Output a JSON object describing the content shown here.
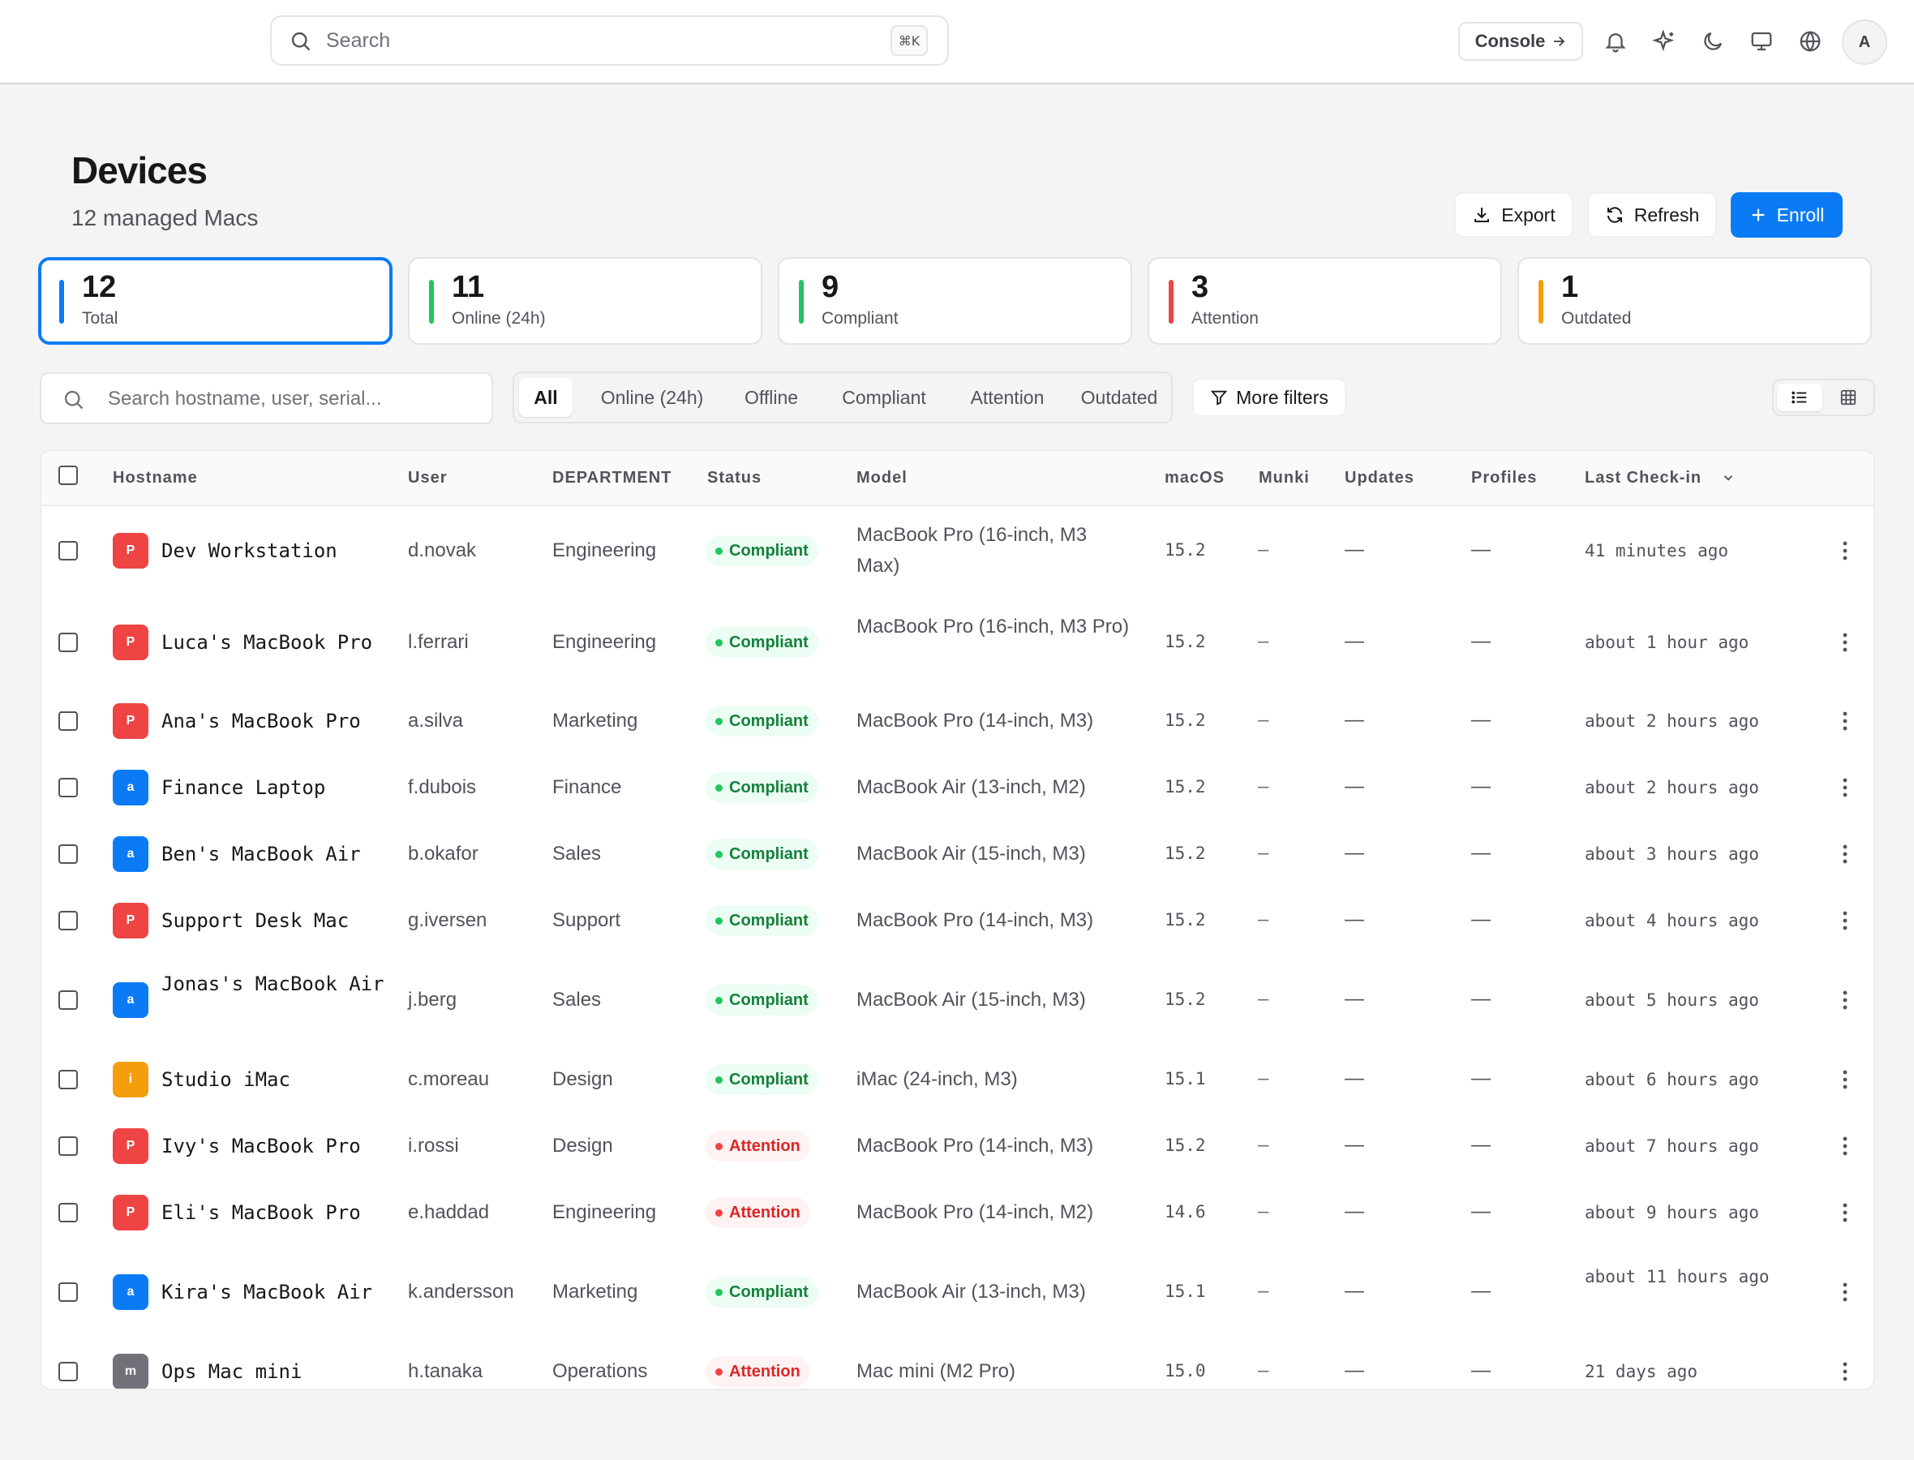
{
  "topbar": {
    "search_placeholder": "Search",
    "search_shortcut": "⌘K",
    "console_label": "Console",
    "icons": [
      "bell-icon",
      "sparkles-icon",
      "moon-icon",
      "monitor-icon",
      "globe-icon"
    ],
    "avatar_initial": "A"
  },
  "header": {
    "title": "Devices",
    "subtitle": "12 managed Macs",
    "export_label": "Export",
    "refresh_label": "Refresh",
    "enroll_label": "Enroll"
  },
  "stats": [
    {
      "value": "12",
      "label": "Total",
      "color": "#0a7bf5"
    },
    {
      "value": "11",
      "label": "Online (24h)",
      "color": "#22c55e"
    },
    {
      "value": "9",
      "label": "Compliant",
      "color": "#22c55e"
    },
    {
      "value": "3",
      "label": "Attention",
      "color": "#ef4444"
    },
    {
      "value": "1",
      "label": "Outdated",
      "color": "#f59e0b"
    }
  ],
  "filters": {
    "search_placeholder": "Search hostname, user, serial...",
    "segments": [
      "All",
      "Online (24h)",
      "Offline",
      "Compliant",
      "Attention",
      "Outdated"
    ],
    "active_segment": "All",
    "more_filters_label": "More filters"
  },
  "table": {
    "columns": {
      "hostname": "Hostname",
      "user": "User",
      "department": "DEPARTMENT",
      "status": "Status",
      "model": "Model",
      "macos": "macOS",
      "munki": "Munki",
      "updates": "Updates",
      "profiles": "Profiles",
      "last_checkin": "Last Check-in"
    },
    "empty_dash_short": "–",
    "empty_dash_long": "—",
    "rows": [
      {
        "platform": "P",
        "platform_color": "#ef4444",
        "hostname": "Dev Workstation",
        "user": "d.novak",
        "department": "Engineering",
        "status": "Compliant",
        "model": "MacBook Pro (16-inch, M3 Max)",
        "macos": "15.2",
        "last_checkin": "41 minutes ago"
      },
      {
        "platform": "P",
        "platform_color": "#ef4444",
        "hostname": "Luca's MacBook Pro",
        "user": "l.ferrari",
        "department": "Engineering",
        "status": "Compliant",
        "model": "MacBook Pro (16-inch, M3 Pro)",
        "macos": "15.2",
        "last_checkin": "about 1 hour ago"
      },
      {
        "platform": "P",
        "platform_color": "#ef4444",
        "hostname": "Ana's MacBook Pro",
        "user": "a.silva",
        "department": "Marketing",
        "status": "Compliant",
        "model": "MacBook Pro (14-inch, M3)",
        "macos": "15.2",
        "last_checkin": "about 2 hours ago"
      },
      {
        "platform": "a",
        "platform_color": "#0a7bf5",
        "hostname": "Finance Laptop",
        "user": "f.dubois",
        "department": "Finance",
        "status": "Compliant",
        "model": "MacBook Air (13-inch, M2)",
        "macos": "15.2",
        "last_checkin": "about 2 hours ago"
      },
      {
        "platform": "a",
        "platform_color": "#0a7bf5",
        "hostname": "Ben's MacBook Air",
        "user": "b.okafor",
        "department": "Sales",
        "status": "Compliant",
        "model": "MacBook Air (15-inch, M3)",
        "macos": "15.2",
        "last_checkin": "about 3 hours ago"
      },
      {
        "platform": "P",
        "platform_color": "#ef4444",
        "hostname": "Support Desk Mac",
        "user": "g.iversen",
        "department": "Support",
        "status": "Compliant",
        "model": "MacBook Pro (14-inch, M3)",
        "macos": "15.2",
        "last_checkin": "about 4 hours ago"
      },
      {
        "platform": "a",
        "platform_color": "#0a7bf5",
        "hostname": "Jonas's MacBook Air",
        "user": "j.berg",
        "department": "Sales",
        "status": "Compliant",
        "model": "MacBook Air (15-inch, M3)",
        "macos": "15.2",
        "last_checkin": "about 5 hours ago"
      },
      {
        "platform": "i",
        "platform_color": "#f59e0b",
        "hostname": "Studio iMac",
        "user": "c.moreau",
        "department": "Design",
        "status": "Compliant",
        "model": "iMac (24-inch, M3)",
        "macos": "15.1",
        "last_checkin": "about 6 hours ago"
      },
      {
        "platform": "P",
        "platform_color": "#ef4444",
        "hostname": "Ivy's MacBook Pro",
        "user": "i.rossi",
        "department": "Design",
        "status": "Attention",
        "model": "MacBook Pro (14-inch, M3)",
        "macos": "15.2",
        "last_checkin": "about 7 hours ago"
      },
      {
        "platform": "P",
        "platform_color": "#ef4444",
        "hostname": "Eli's MacBook Pro",
        "user": "e.haddad",
        "department": "Engineering",
        "status": "Attention",
        "model": "MacBook Pro (14-inch, M2)",
        "macos": "14.6",
        "last_checkin": "about 9 hours ago"
      },
      {
        "platform": "a",
        "platform_color": "#0a7bf5",
        "hostname": "Kira's MacBook Air",
        "user": "k.andersson",
        "department": "Marketing",
        "status": "Compliant",
        "model": "MacBook Air (13-inch, M3)",
        "macos": "15.1",
        "last_checkin": "about 11 hours ago"
      },
      {
        "platform": "m",
        "platform_color": "#71717a",
        "hostname": "Ops Mac mini",
        "user": "h.tanaka",
        "department": "Operations",
        "status": "Attention",
        "model": "Mac mini (M2 Pro)",
        "macos": "15.0",
        "last_checkin": "21 days ago"
      }
    ]
  },
  "colors": {
    "accent": "#0a7bf5",
    "compliant_bg": "#ecfdf3",
    "compliant_text": "#15803d",
    "compliant_dot": "#22c55e",
    "attention_bg": "#fef2f2",
    "attention_text": "#dc2626",
    "attention_dot": "#ef4444"
  }
}
